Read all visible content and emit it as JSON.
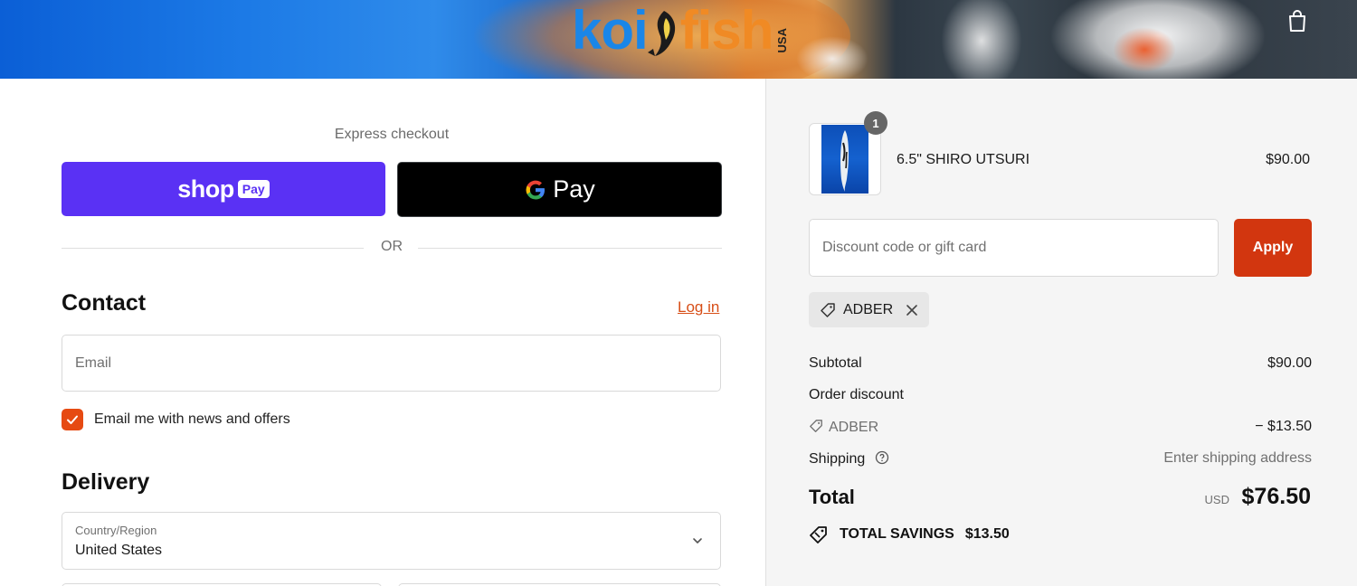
{
  "header": {
    "logo_text_1": "koi",
    "logo_text_2": "fish",
    "logo_suffix": "USA"
  },
  "express": {
    "label": "Express checkout",
    "shop_pay": {
      "brand": "shop",
      "badge": "Pay"
    },
    "google_pay": {
      "label": "Pay"
    },
    "divider": "OR"
  },
  "contact": {
    "heading": "Contact",
    "login_link": "Log in",
    "email_placeholder": "Email",
    "email_value": "",
    "newsletter_label": "Email me with news and offers",
    "newsletter_checked": true
  },
  "delivery": {
    "heading": "Delivery",
    "country_caption": "Country/Region",
    "country_value": "United States"
  },
  "cart": {
    "items": [
      {
        "quantity": "1",
        "name": "6.5\" SHIRO UTSURI",
        "price": "$90.00"
      }
    ]
  },
  "discount": {
    "placeholder": "Discount code or gift card",
    "apply_label": "Apply",
    "applied_code": "ADBER"
  },
  "summary": {
    "subtotal_label": "Subtotal",
    "subtotal_value": "$90.00",
    "order_discount_label": "Order discount",
    "discount_code": "ADBER",
    "discount_value": "− $13.50",
    "shipping_label": "Shipping",
    "shipping_value": "Enter shipping address",
    "total_label": "Total",
    "currency": "USD",
    "total_value": "$76.50",
    "savings_label": "TOTAL SAVINGS",
    "savings_value": "$13.50"
  },
  "colors": {
    "shop_pay": "#5a31f4",
    "accent": "#d2360f",
    "link": "#d74e17",
    "checkbox": "#e64a12"
  }
}
